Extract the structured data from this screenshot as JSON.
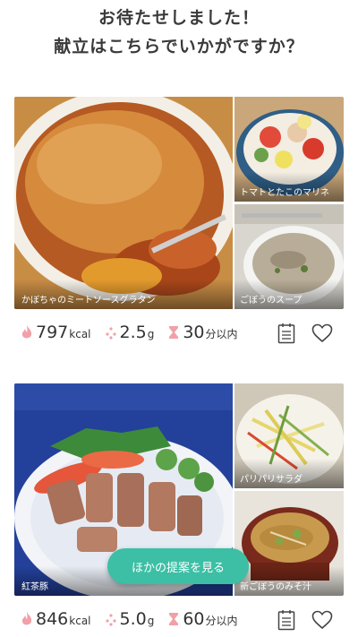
{
  "heading": {
    "line1": "お待たせしました！",
    "line2": "献立はこちらでいかがですか？"
  },
  "menus": [
    {
      "main_dish": "かぼちゃのミートソースグラタン",
      "side_dish_1": "トマトとたこのマリネ",
      "side_dish_2": "ごぼうのスープ",
      "calories": {
        "value": "797",
        "unit": "kcal"
      },
      "salt": {
        "value": "2.5",
        "unit": "g"
      },
      "time": {
        "value": "30",
        "unit": "分以内"
      }
    },
    {
      "main_dish": "紅茶豚",
      "side_dish_1": "パリパリサラダ",
      "side_dish_2": "新ごぼうのみそ汁",
      "calories": {
        "value": "846",
        "unit": "kcal"
      },
      "salt": {
        "value": "5.0",
        "unit": "g"
      },
      "time": {
        "value": "60",
        "unit": "分以内"
      }
    }
  ],
  "other_suggestions_button": "ほかの提案を見る",
  "icons": {
    "calories": "flame-icon",
    "salt": "salt-dots-icon",
    "time": "hourglass-icon",
    "calendar": "calendar-list-icon",
    "favorite": "heart-outline-icon"
  },
  "colors": {
    "accent": "#3cbfa5",
    "icon_pink": "#f2a0a8",
    "text": "#333333"
  }
}
